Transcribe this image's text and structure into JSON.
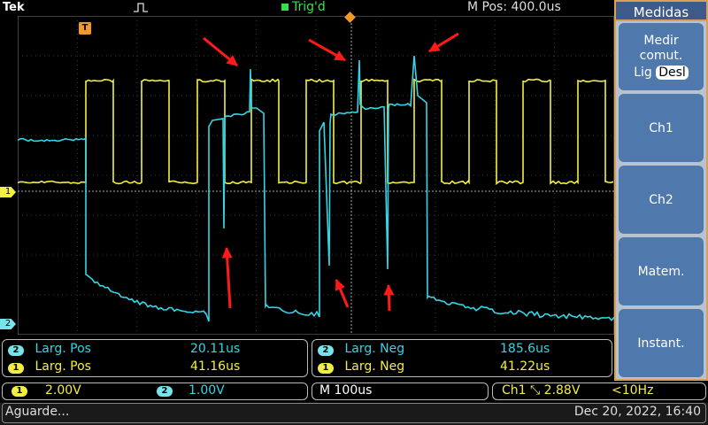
{
  "header": {
    "brand": "Tek",
    "trigger_status": "Trig'd",
    "position": "M Pos: 400.0us"
  },
  "side_menu": {
    "title": "Medidas",
    "buttons": [
      {
        "label": "Medir\ncomut.",
        "toggle_on": "Lig",
        "toggle_off": "Desl"
      },
      {
        "label": "Ch1"
      },
      {
        "label": "Ch2"
      },
      {
        "label": "Matem."
      },
      {
        "label": "Instant."
      }
    ]
  },
  "markers": {
    "trigger": "T",
    "ch1": "1",
    "ch2": "2"
  },
  "measurements": [
    {
      "channel": "2",
      "name": "Larg. Pos",
      "value": "20.11us"
    },
    {
      "channel": "1",
      "name": "Larg. Pos",
      "value": "41.16us"
    },
    {
      "channel": "2",
      "name": "Larg. Neg",
      "value": "185.6us"
    },
    {
      "channel": "1",
      "name": "Larg. Neg",
      "value": "41.22us"
    }
  ],
  "status": {
    "ch1_badge": "1",
    "ch1_scale": "2.00V",
    "ch2_badge": "2",
    "ch2_scale": "1.00V",
    "timebase": "M 100us",
    "trigger": "Ch1 ⤡ 2.88V",
    "trigger_freq": "<10Hz"
  },
  "footer": {
    "state": "Aguarde...",
    "datetime": "Dec 20, 2022, 16:40"
  },
  "colors": {
    "ch1": "#f3ee43",
    "ch2": "#33d6e6",
    "arrows": "#ff1a1a"
  }
}
